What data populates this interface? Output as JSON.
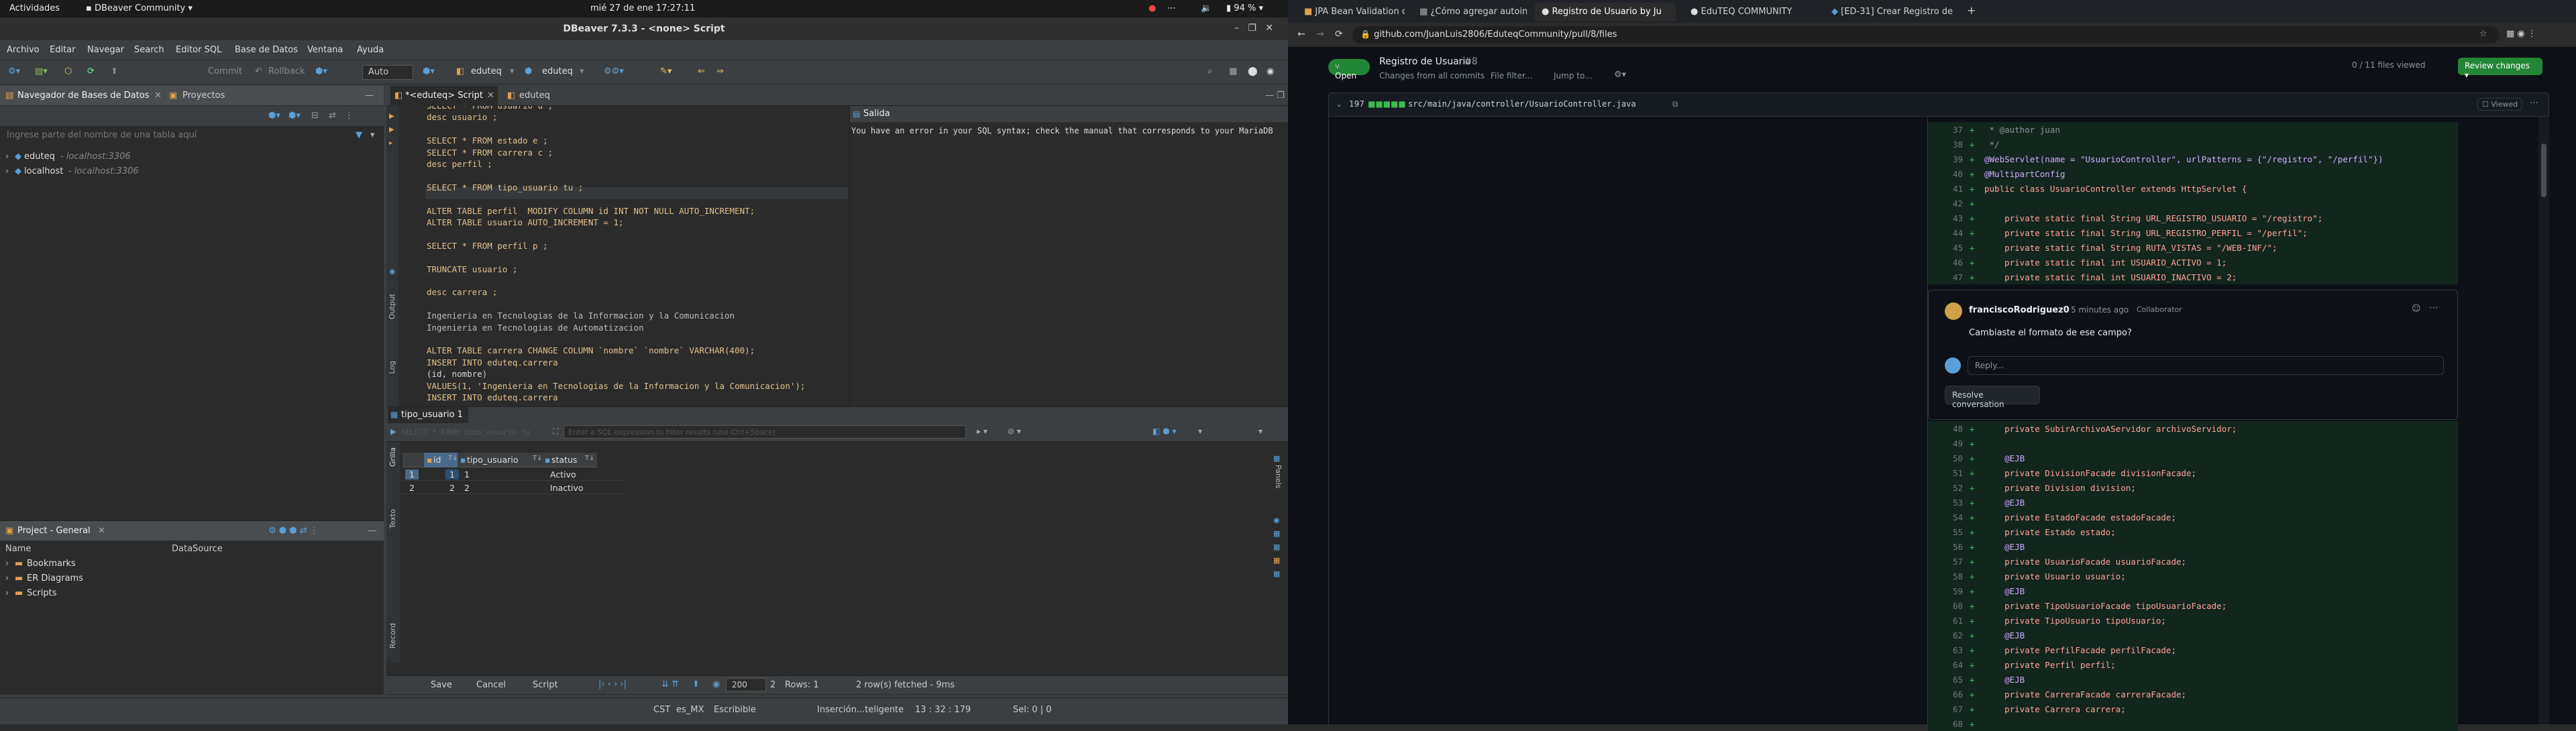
{
  "topbar": {
    "activities": "Actividades",
    "app": "DBeaver Community",
    "clock": "mié 27 de ene  17:27:11",
    "battery": "94 %"
  },
  "dbeaver": {
    "title": "DBeaver 7.3.3 - <none> Script",
    "menu": [
      "Archivo",
      "Editar",
      "Navegar",
      "Search",
      "Editor SQL",
      "Base de Datos",
      "Ventana",
      "Ayuda"
    ],
    "toolbar": {
      "commit": "Commit",
      "rollback": "Rollback",
      "mode": "Auto",
      "conn1": "eduteq",
      "conn2": "eduteq"
    },
    "navigator": {
      "tab1": "Navegador de Bases de Datos",
      "tab2": "Proyectos",
      "filter_placeholder": "Ingrese parte del nombre de una tabla aquí",
      "items": [
        {
          "name": "eduteq",
          "host": " - localhost:3306"
        },
        {
          "name": "localhost",
          "host": " - localhost:3306"
        }
      ]
    },
    "project": {
      "title": "Project - General",
      "col_name": "Name",
      "col_ds": "DataSource",
      "items": [
        "Bookmarks",
        "ER Diagrams",
        "Scripts"
      ]
    },
    "editor": {
      "tab1": "*<eduteq> Script",
      "tab2": "eduteq",
      "lines": [
        "SELECT * FROM usuario u ;",
        "desc usuario ;",
        "",
        "SELECT * FROM estado e ;",
        "SELECT * FROM carrera c ;",
        "desc perfil ;",
        "",
        "SELECT * FROM tipo_usuario tu ;",
        "",
        "ALTER TABLE perfil  MODIFY COLUMN id INT NOT NULL AUTO_INCREMENT;",
        "ALTER TABLE usuario AUTO_INCREMENT = 1;",
        "",
        "SELECT * FROM perfil p ;",
        "",
        "TRUNCATE usuario ;",
        "",
        "desc carrera ;",
        "",
        "Ingenieria en Tecnologias de la Informacion y la Comunicacion",
        "Ingenieria en Tecnologias de Automatizacion",
        "",
        "ALTER TABLE carrera CHANGE COLUMN `nombre` `nombre` VARCHAR(400);",
        "INSERT INTO eduteq.carrera",
        "(id, nombre)",
        "VALUES(1, 'Ingenieria en Tecnologias de la Informacion y la Comunicacion');",
        "INSERT INTO eduteq.carrera"
      ],
      "output_title": "Salida",
      "output_text": "You have an error in your SQL syntax; check the manual that corresponds to your MariaDB",
      "side_labels": [
        "Output",
        "Log"
      ]
    },
    "results": {
      "tab": "tipo_usuario 1",
      "query": "SELECT * FROM tipo_usuario tu",
      "filter_placeholder": "Enter a SQL expression to filter results (use Ctrl+Space)",
      "columns": [
        "id",
        "tipo_usuario",
        "status"
      ],
      "rows": [
        {
          "n": "1",
          "id": "1",
          "tipo": "1",
          "status": "Activo"
        },
        {
          "n": "2",
          "id": "2",
          "tipo": "2",
          "status": "Inactivo"
        }
      ],
      "side": [
        "Grilla",
        "Texto",
        "Record"
      ],
      "right": "Panels",
      "bottom": {
        "save": "Save",
        "cancel": "Cancel",
        "script": "Script",
        "limit": "200",
        "rows": "Rows: 1",
        "fetched": "2 row(s) fetched - 9ms",
        "count": "2"
      }
    },
    "status": {
      "tz": "CST",
      "locale": "es_MX",
      "mode": "Escribible",
      "insert": "Inserción...teligente",
      "pos": "13 : 32 : 179",
      "sel": "Sel: 0 | 0"
    }
  },
  "browser": {
    "tabs": [
      "JPA Bean Validation con",
      "¿Cómo agregar autoincr",
      "Registro de Usuario by Ju",
      "EduTEQ COMMUNITY",
      "[ED-31] Crear Registro de"
    ],
    "url": "github.com/JuanLuis2806/EduteqCommunity/pull/8/files",
    "pr": {
      "state": "Open",
      "title": "Registro de Usuario",
      "number": "#8",
      "changes": "Changes from all commits",
      "file_filter": "File filter...",
      "jump": "Jump to...",
      "viewed": "0 / 11 files viewed",
      "review": "Review changes",
      "file_count": "197",
      "file_path": "src/main/java/controller/UsuarioController.java",
      "viewed_label": "Viewed"
    },
    "comment": {
      "author": "franciscoRodriguez0",
      "time": "5 minutes ago",
      "role": "Collaborator",
      "body": "Cambiaste el formato de ese campo?",
      "reply": "Reply...",
      "resolve": "Resolve conversation"
    },
    "diff_top": [
      {
        "n": "37",
        "t": " * @author juan"
      },
      {
        "n": "38",
        "t": " */"
      },
      {
        "n": "39",
        "t": "@WebServlet(name = \"UsuarioController\", urlPatterns = {\"/registro\", \"/perfil\"})"
      },
      {
        "n": "40",
        "t": "@MultipartConfig"
      },
      {
        "n": "41",
        "t": "public class UsuarioController extends HttpServlet {"
      },
      {
        "n": "42",
        "t": ""
      },
      {
        "n": "43",
        "t": "    private static final String URL_REGISTRO_USUARIO = \"/registro\";"
      },
      {
        "n": "44",
        "t": "    private static final String URL_REGISTRO_PERFIL = \"/perfil\";"
      },
      {
        "n": "45",
        "t": "    private static final String RUTA_VISTAS = \"/WEB-INF/\";"
      },
      {
        "n": "46",
        "t": "    private static final int USUARIO_ACTIVO = 1;"
      },
      {
        "n": "47",
        "t": "    private static final int USUARIO_INACTIVO = 2;"
      }
    ],
    "diff_bottom": [
      {
        "n": "48",
        "t": "    private SubirArchivoAServidor archivoServidor;"
      },
      {
        "n": "49",
        "t": ""
      },
      {
        "n": "50",
        "t": "    @EJB"
      },
      {
        "n": "51",
        "t": "    private DivisionFacade divisionFacade;"
      },
      {
        "n": "52",
        "t": "    private Division division;"
      },
      {
        "n": "53",
        "t": "    @EJB"
      },
      {
        "n": "54",
        "t": "    private EstadoFacade estadoFacade;"
      },
      {
        "n": "55",
        "t": "    private Estado estado;"
      },
      {
        "n": "56",
        "t": "    @EJB"
      },
      {
        "n": "57",
        "t": "    private UsuarioFacade usuarioFacade;"
      },
      {
        "n": "58",
        "t": "    private Usuario usuario;"
      },
      {
        "n": "59",
        "t": "    @EJB"
      },
      {
        "n": "60",
        "t": "    private TipoUsuarioFacade tipoUsuarioFacade;"
      },
      {
        "n": "61",
        "t": "    private TipoUsuario tipoUsuario;"
      },
      {
        "n": "62",
        "t": "    @EJB"
      },
      {
        "n": "63",
        "t": "    private PerfilFacade perfilFacade;"
      },
      {
        "n": "64",
        "t": "    private Perfil perfil;"
      },
      {
        "n": "65",
        "t": "    @EJB"
      },
      {
        "n": "66",
        "t": "    private CarreraFacade carreraFacade;"
      },
      {
        "n": "67",
        "t": "    private Carrera carrera;"
      },
      {
        "n": "68",
        "t": ""
      }
    ]
  }
}
